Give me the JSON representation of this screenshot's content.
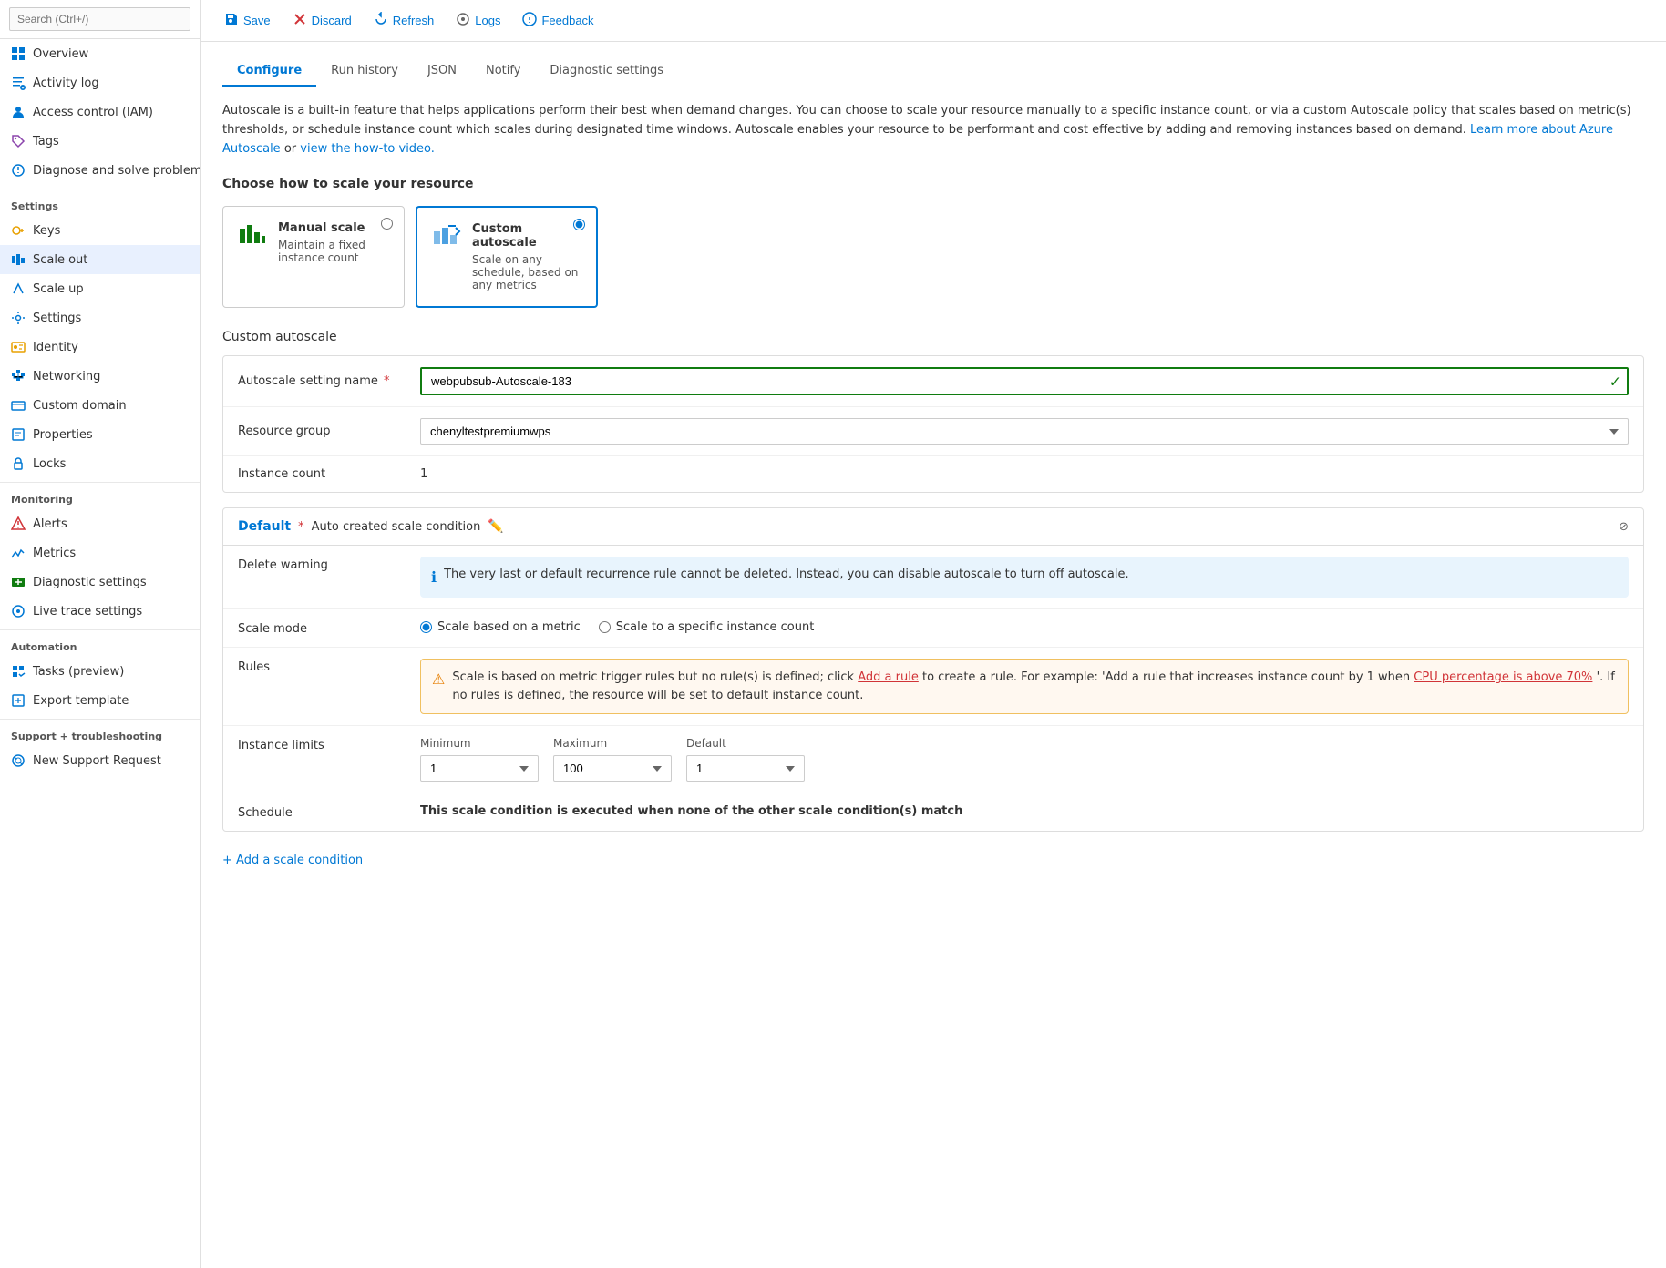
{
  "sidebar": {
    "search_placeholder": "Search (Ctrl+/)",
    "items": [
      {
        "id": "overview",
        "label": "Overview",
        "icon": "⬜",
        "active": false
      },
      {
        "id": "activity-log",
        "label": "Activity log",
        "active": false
      },
      {
        "id": "access-control",
        "label": "Access control (IAM)",
        "active": false
      },
      {
        "id": "tags",
        "label": "Tags",
        "active": false
      },
      {
        "id": "diagnose",
        "label": "Diagnose and solve problems",
        "active": false
      }
    ],
    "sections": {
      "settings": {
        "label": "Settings",
        "items": [
          {
            "id": "keys",
            "label": "Keys"
          },
          {
            "id": "scale-out",
            "label": "Scale out",
            "active": true
          },
          {
            "id": "scale-up",
            "label": "Scale up"
          },
          {
            "id": "settings",
            "label": "Settings"
          },
          {
            "id": "identity",
            "label": "Identity"
          },
          {
            "id": "networking",
            "label": "Networking"
          },
          {
            "id": "custom-domain",
            "label": "Custom domain"
          },
          {
            "id": "properties",
            "label": "Properties"
          },
          {
            "id": "locks",
            "label": "Locks"
          }
        ]
      },
      "monitoring": {
        "label": "Monitoring",
        "items": [
          {
            "id": "alerts",
            "label": "Alerts"
          },
          {
            "id": "metrics",
            "label": "Metrics"
          },
          {
            "id": "diagnostic-settings",
            "label": "Diagnostic settings"
          },
          {
            "id": "live-trace",
            "label": "Live trace settings"
          }
        ]
      },
      "automation": {
        "label": "Automation",
        "items": [
          {
            "id": "tasks",
            "label": "Tasks (preview)"
          },
          {
            "id": "export-template",
            "label": "Export template"
          }
        ]
      },
      "support": {
        "label": "Support + troubleshooting",
        "items": [
          {
            "id": "new-support",
            "label": "New Support Request"
          }
        ]
      }
    }
  },
  "toolbar": {
    "save_label": "Save",
    "discard_label": "Discard",
    "refresh_label": "Refresh",
    "logs_label": "Logs",
    "feedback_label": "Feedback"
  },
  "tabs": [
    {
      "id": "configure",
      "label": "Configure",
      "active": true
    },
    {
      "id": "run-history",
      "label": "Run history",
      "active": false
    },
    {
      "id": "json",
      "label": "JSON",
      "active": false
    },
    {
      "id": "notify",
      "label": "Notify",
      "active": false
    },
    {
      "id": "diagnostic-settings",
      "label": "Diagnostic settings",
      "active": false
    }
  ],
  "description": {
    "text": "Autoscale is a built-in feature that helps applications perform their best when demand changes. You can choose to scale your resource manually to a specific instance count, or via a custom Autoscale policy that scales based on metric(s) thresholds, or schedule instance count which scales during designated time windows. Autoscale enables your resource to be performant and cost effective by adding and removing instances based on demand.",
    "link1_text": "Learn more about Azure Autoscale",
    "link1_sep": " or ",
    "link2_text": "view the how-to video."
  },
  "scale_section_title": "Choose how to scale your resource",
  "scale_options": {
    "manual": {
      "title": "Manual scale",
      "description": "Maintain a fixed instance count",
      "selected": false
    },
    "custom": {
      "title": "Custom autoscale",
      "description": "Scale on any schedule, based on any metrics",
      "selected": true
    }
  },
  "custom_autoscale_label": "Custom autoscale",
  "form": {
    "setting_name_label": "Autoscale setting name",
    "setting_name_required": true,
    "setting_name_value": "webpubsub-Autoscale-183",
    "resource_group_label": "Resource group",
    "resource_group_value": "chenyltestpremiumwps",
    "instance_count_label": "Instance count",
    "instance_count_value": "1"
  },
  "condition": {
    "default_label": "Default",
    "required_star": "*",
    "name": "Auto created scale condition",
    "delete_warning_label": "Delete warning",
    "delete_warning_text": "The very last or default recurrence rule cannot be deleted. Instead, you can disable autoscale to turn off autoscale.",
    "scale_mode_label": "Scale mode",
    "scale_mode_metric": "Scale based on a metric",
    "scale_mode_instance": "Scale to a specific instance count",
    "scale_mode_selected": "metric",
    "rules_label": "Rules",
    "rules_warning": "Scale is based on metric trigger rules but no rule(s) is defined; click",
    "rules_link": "Add a rule",
    "rules_warning2": "to create a rule. For example: 'Add a rule that increases instance count by 1 when",
    "rules_cpu": "CPU percentage is above 70%",
    "rules_warning3": "'. If no rules is defined, the resource will be set to default instance count.",
    "instance_limits_label": "Instance limits",
    "minimum_label": "Minimum",
    "minimum_value": "1",
    "maximum_label": "Maximum",
    "maximum_value": "100",
    "default_limit_label": "Default",
    "default_limit_value": "1",
    "schedule_label": "Schedule",
    "schedule_text": "This scale condition is executed when none of the other scale condition(s) match"
  },
  "add_scale_condition_label": "+ Add a scale condition",
  "resource_group_options": [
    "chenyltestpremiumwps"
  ],
  "minimum_options": [
    "1"
  ],
  "maximum_options": [
    "100"
  ],
  "default_options": [
    "1"
  ]
}
